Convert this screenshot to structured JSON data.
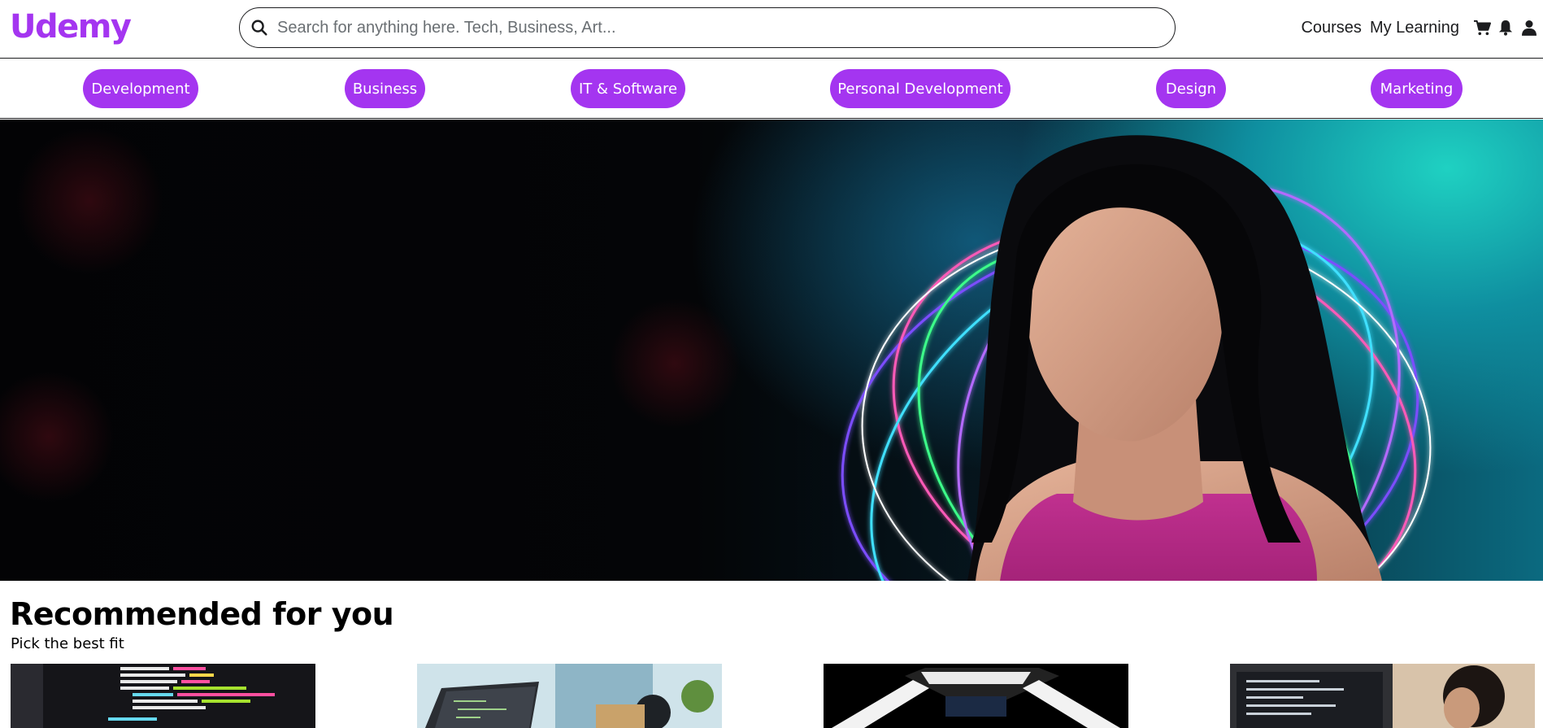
{
  "header": {
    "logo": "Udemy",
    "search_placeholder": "Search for anything here. Tech, Business, Art...",
    "nav": {
      "courses": "Courses",
      "my_learning": "My Learning"
    },
    "icons": [
      "search-icon",
      "cart-icon",
      "bell-icon",
      "user-icon"
    ]
  },
  "categories": [
    {
      "label": "Development"
    },
    {
      "label": "Business"
    },
    {
      "label": "IT & Software"
    },
    {
      "label": "Personal Development"
    },
    {
      "label": "Design"
    },
    {
      "label": "Marketing"
    }
  ],
  "recommended": {
    "title": "Recommended for you",
    "subtitle": "Pick the best fit"
  },
  "colors": {
    "brand": "#a435f0",
    "text": "#1c1d1f",
    "pill_text": "#ffffff"
  }
}
